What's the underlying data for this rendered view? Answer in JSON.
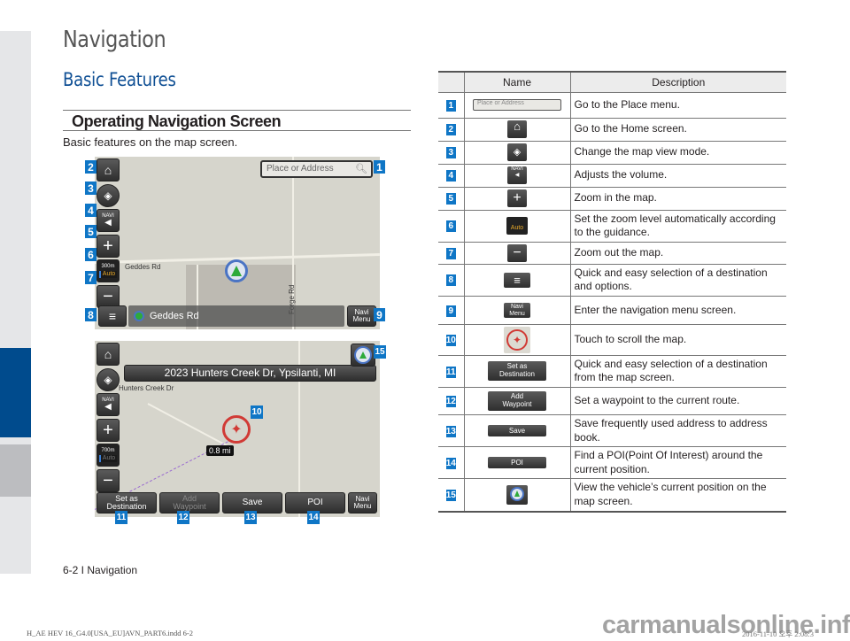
{
  "page": {
    "chapter_title": "Navigation",
    "section_title": "Basic Features",
    "subsection_title": "Operating Navigation Screen",
    "intro": "Basic features on the map screen."
  },
  "map1": {
    "search_placeholder": "Place or Address",
    "road_label_horizontal": "Geddes Rd",
    "road_label_vertical": "Forge Rd",
    "current_road": "Geddes Rd",
    "navi_label": "NAVI",
    "zoom_scale": "300m",
    "zoom_auto": "Auto",
    "navi_menu": "Navi Menu",
    "callouts": [
      "1",
      "2",
      "3",
      "4",
      "5",
      "6",
      "7",
      "8",
      "9"
    ]
  },
  "map2": {
    "address_banner": "2023 Hunters Creek Dr, Ypsilanti, MI",
    "road_label": "Hunters Creek Dr",
    "distance": "0.8 mi",
    "navi_label": "NAVI",
    "zoom_scale": "700m",
    "zoom_auto": "Auto",
    "buttons": {
      "set_destination": "Set as Destination",
      "add_waypoint": "Add Waypoint",
      "save": "Save",
      "poi": "POI",
      "navi_menu": "Navi Menu"
    },
    "callouts": [
      "10",
      "11",
      "12",
      "13",
      "14",
      "15"
    ]
  },
  "table": {
    "headers": [
      "",
      "Name",
      "Description"
    ],
    "rows": [
      {
        "num": "1",
        "icon": "search-box",
        "icon_text": "Place or Address",
        "description": "Go to the Place menu."
      },
      {
        "num": "2",
        "icon": "home-icon",
        "icon_text": "",
        "description": "Go to the Home screen."
      },
      {
        "num": "3",
        "icon": "compass-icon",
        "icon_text": "",
        "description": "Change the map view mode."
      },
      {
        "num": "4",
        "icon": "volume-icon",
        "icon_text": "NAVI",
        "description": "Adjusts the volume."
      },
      {
        "num": "5",
        "icon": "plus-icon",
        "icon_text": "",
        "description": "Zoom in the map."
      },
      {
        "num": "6",
        "icon": "auto-zoom-icon",
        "icon_text": "Auto",
        "description": "Set the zoom level automatically according to the guidance."
      },
      {
        "num": "7",
        "icon": "minus-icon",
        "icon_text": "",
        "description": "Zoom out the map."
      },
      {
        "num": "8",
        "icon": "menu-icon",
        "icon_text": "",
        "description": "Quick and easy selection of a destination and options."
      },
      {
        "num": "9",
        "icon": "navi-menu-button",
        "icon_text": "Navi Menu",
        "description": "Enter the navigation menu screen."
      },
      {
        "num": "10",
        "icon": "crosshair-icon",
        "icon_text": "",
        "description": "Touch to scroll the map."
      },
      {
        "num": "11",
        "icon": "set-destination-button",
        "icon_text": "Set as Destination",
        "description": "Quick and easy selection of a destination from the map screen."
      },
      {
        "num": "12",
        "icon": "add-waypoint-button",
        "icon_text": "Add Waypoint",
        "description": "Set a waypoint to the current route."
      },
      {
        "num": "13",
        "icon": "save-button",
        "icon_text": "Save",
        "description": "Save frequently used address to address book."
      },
      {
        "num": "14",
        "icon": "poi-button",
        "icon_text": "POI",
        "description": "Find a POI(Point Of Interest) around the current position."
      },
      {
        "num": "15",
        "icon": "current-position-icon",
        "icon_text": "",
        "description": "View the vehicle’s current position on the map screen."
      }
    ]
  },
  "footer": {
    "page_ref": "6-2 I Navigation",
    "file": "H_AE HEV 16_G4.0[USA_EU]AVN_PART6.indd   6-2",
    "date": "2016-11-10   오후 2:08:3",
    "watermark": "carmanualsonline.info"
  },
  "colors": {
    "accent_blue": "#0f4f94",
    "callout_blue": "#0f76c6",
    "side_tab_blue": "#004b8d"
  }
}
